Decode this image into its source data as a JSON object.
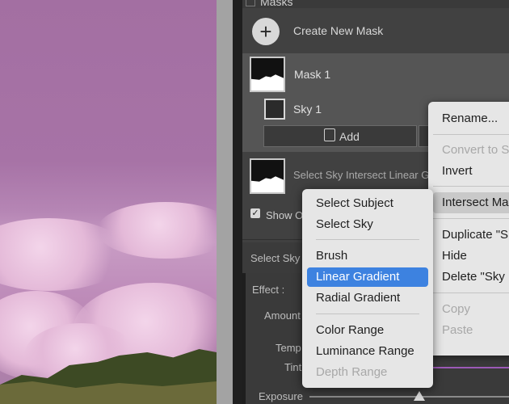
{
  "panel": {
    "header_label": "Masks",
    "create_new_mask": "Create New Mask",
    "mask_name": "Mask 1",
    "sky_name": "Sky 1",
    "add_label": "Add",
    "intersect_label": "Select Sky Intersect Linear Gr",
    "show_overlay": "Show O",
    "select_sky_bar": "Select Sky",
    "effect_label": "Effect :",
    "amount_label": "Amount",
    "temp_label": "Temp",
    "tint_label": "Tint",
    "exposure_label": "Exposure",
    "exposure_value": 0.5
  },
  "context_menu": {
    "items": [
      {
        "label": "Rename...",
        "enabled": true
      },
      {
        "label": "Convert to S",
        "enabled": false
      },
      {
        "label": "Invert",
        "enabled": true
      },
      {
        "label": "Intersect Ma",
        "enabled": true,
        "highlighted": true
      },
      {
        "label": "Duplicate \"S",
        "enabled": true
      },
      {
        "label": "Hide",
        "enabled": true
      },
      {
        "label": "Delete \"Sky",
        "enabled": true
      },
      {
        "label": "Copy",
        "enabled": false
      },
      {
        "label": "Paste",
        "enabled": false
      }
    ]
  },
  "submenu": {
    "items": [
      {
        "label": "Select Subject",
        "enabled": true
      },
      {
        "label": "Select Sky",
        "enabled": true
      },
      {
        "label": "Brush",
        "enabled": true
      },
      {
        "label": "Linear Gradient",
        "enabled": true,
        "highlighted": true
      },
      {
        "label": "Radial Gradient",
        "enabled": true
      },
      {
        "label": "Color Range",
        "enabled": true
      },
      {
        "label": "Luminance Range",
        "enabled": true
      },
      {
        "label": "Depth Range",
        "enabled": false
      }
    ]
  },
  "colors": {
    "highlight": "#3d82e0",
    "panel_bg": "#414141",
    "menu_bg": "#e6e6e6"
  }
}
